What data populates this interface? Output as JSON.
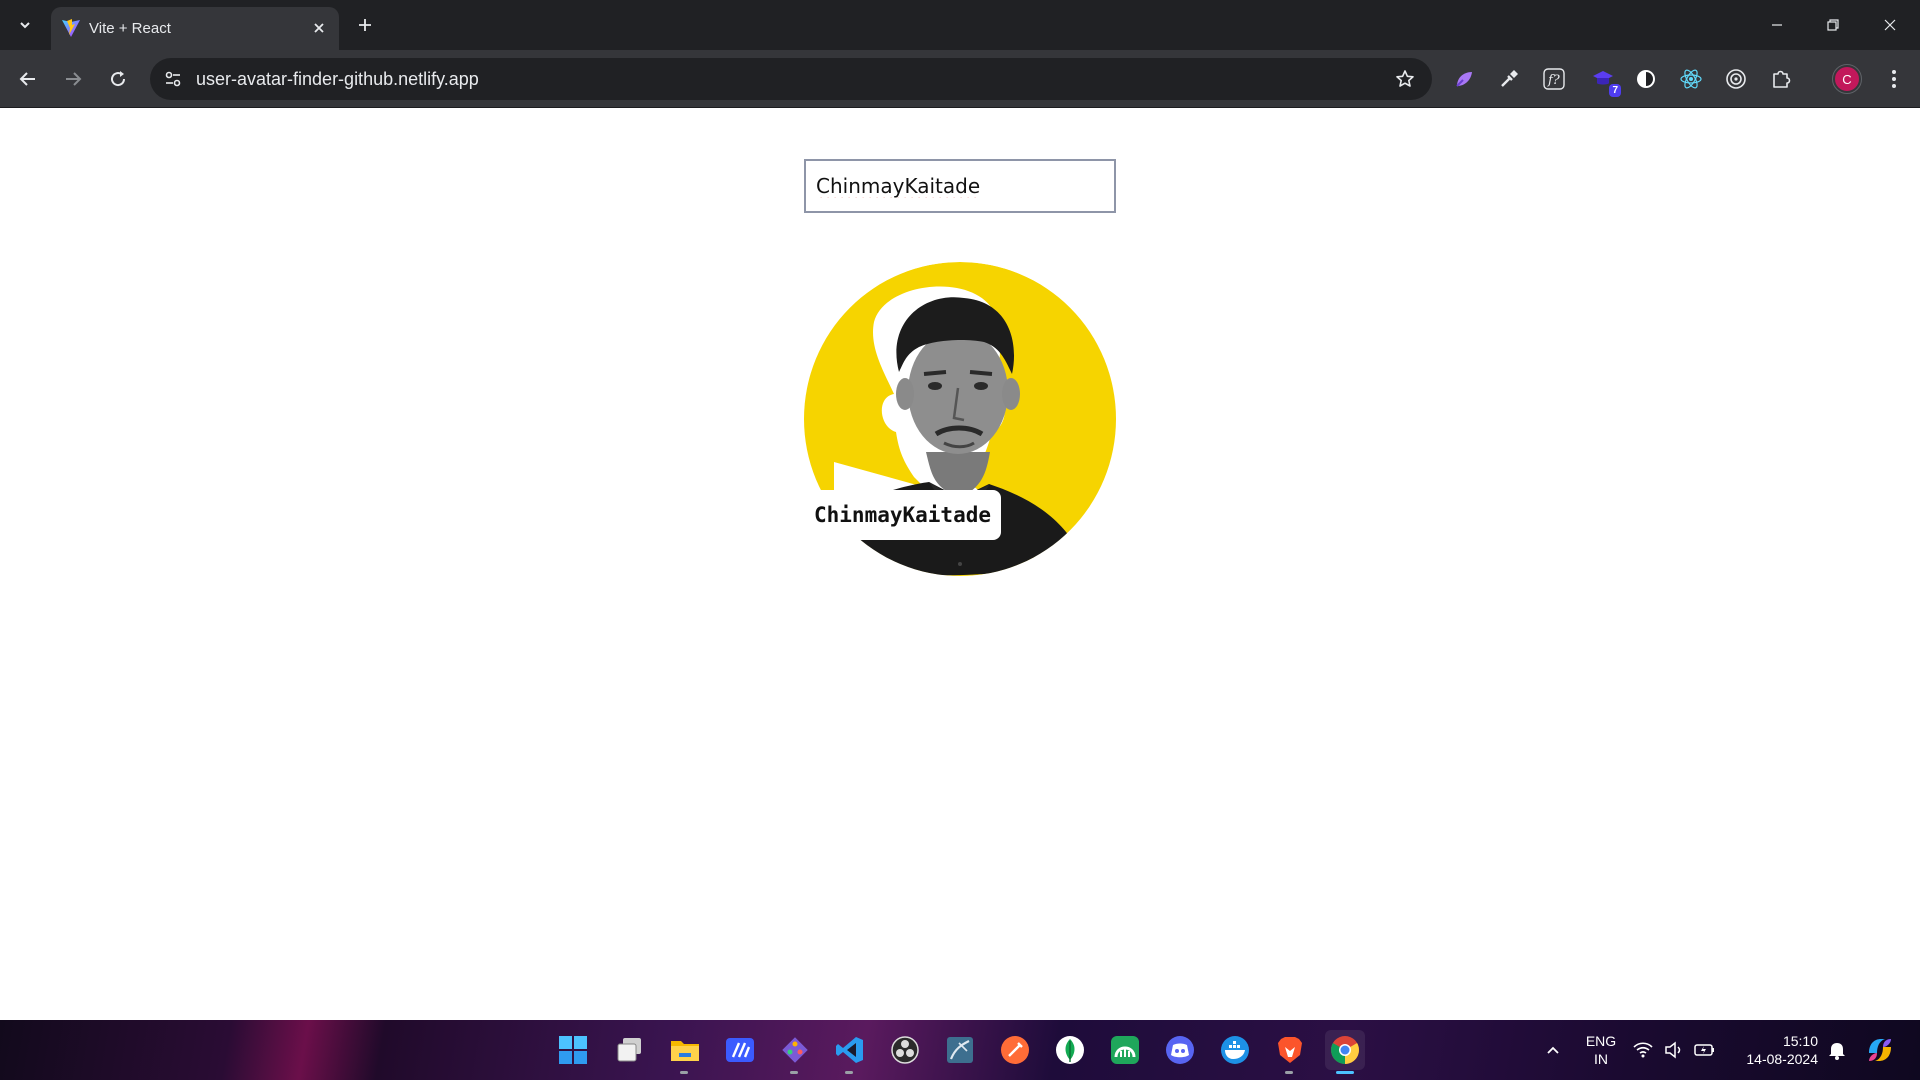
{
  "browser": {
    "tab_title": "Vite + React",
    "url": "user-avatar-finder-github.netlify.app",
    "profile_initial": "C",
    "extension_badge": "7"
  },
  "page": {
    "search_value": "ChinmayKaitade",
    "username_label": "ChinmayKaitade"
  },
  "taskbar": {
    "language": "ENG",
    "region": "IN",
    "time": "15:10",
    "date": "14-08-2024",
    "apps": [
      "start-menu",
      "task-view",
      "file-explorer",
      "windsurf-editor",
      "git-tool",
      "vs-code",
      "obs-studio",
      "mysql-workbench",
      "postman",
      "mongodb-compass",
      "gitkraken",
      "discord",
      "docker",
      "brave",
      "chrome"
    ]
  },
  "colors": {
    "avatar_background": "#f6d400",
    "tab_bar": "#202124",
    "toolbar": "#35363a",
    "profile": "#c2185b"
  }
}
